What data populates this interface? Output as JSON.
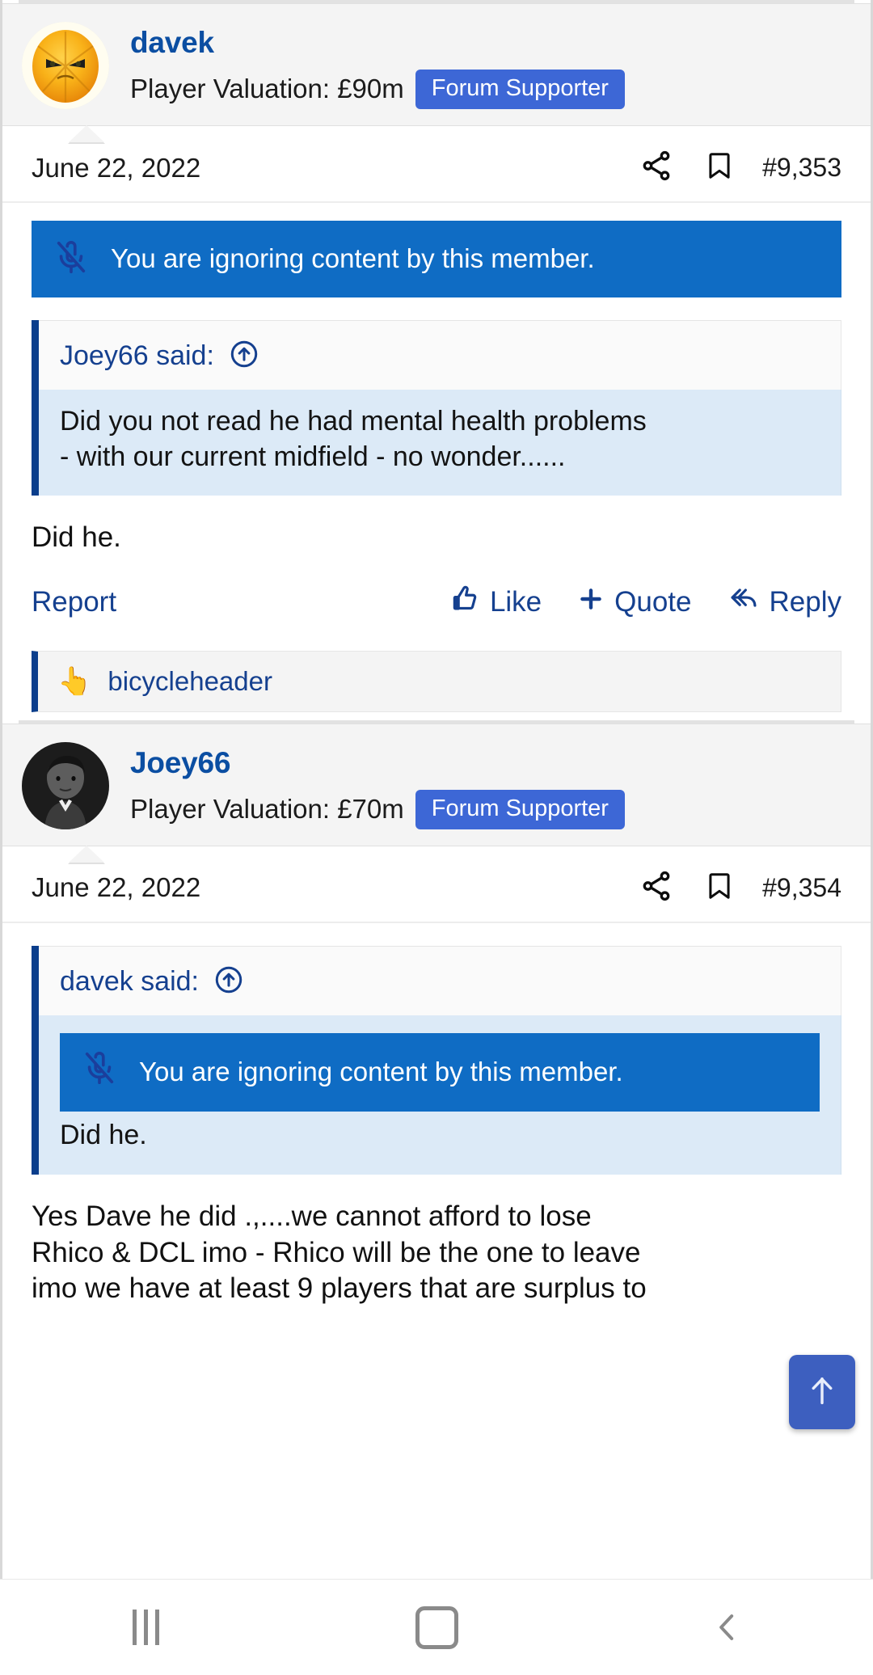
{
  "posts": [
    {
      "username": "davek",
      "valuation": "Player Valuation: £90m",
      "badge": "Forum Supporter",
      "avatar_type": "angry-orange-avatar",
      "date": "June 22, 2022",
      "post_number": "#9,353",
      "ignore_notice": "You are ignoring content by this member.",
      "quote": {
        "author": "Joey66 said:",
        "line1": "Did you not read he had mental health problems",
        "line2": "- with our current midfield - no wonder......"
      },
      "body": "Did he.",
      "actions": {
        "report": "Report",
        "like": "Like",
        "quote": "Quote",
        "reply": "Reply"
      },
      "reactions": {
        "emoji": "point-up-hand-emoji",
        "names": "bicycleheader"
      }
    },
    {
      "username": "Joey66",
      "valuation": "Player Valuation: £70m",
      "badge": "Forum Supporter",
      "avatar_type": "photo-portrait-avatar",
      "date": "June 22, 2022",
      "post_number": "#9,354",
      "quote": {
        "author": "davek said:",
        "ignore_notice": "You are ignoring content by this member.",
        "body": "Did he."
      },
      "body_line1": "Yes Dave he did .,....we cannot afford to lose",
      "body_line2": "Rhico & DCL imo - Rhico will be the one to leave",
      "body_line3": "imo we have at least 9 players that are surplus to"
    }
  ],
  "scroll_top_button": {
    "icon": "arrow-up-icon"
  },
  "navbar": {
    "recents": "recents-icon",
    "home": "home-icon",
    "back": "back-icon"
  },
  "icons": {
    "share": "share-icon",
    "bookmark": "bookmark-icon",
    "quote_jump": "arrow-up-circle-icon",
    "mute": "mute-icon",
    "thumbs_up": "thumbs-up-icon",
    "plus": "plus-icon",
    "reply_arrow": "reply-arrow-icon"
  },
  "colors": {
    "link": "#15408f",
    "username": "#0b4ea2",
    "badge_bg": "#3d67d6",
    "ignore_bg": "#0f6cc4",
    "quote_bg": "#dceaf7",
    "quote_bar": "#0b3e8c",
    "scroll_top_bg": "#3d5fbf"
  }
}
